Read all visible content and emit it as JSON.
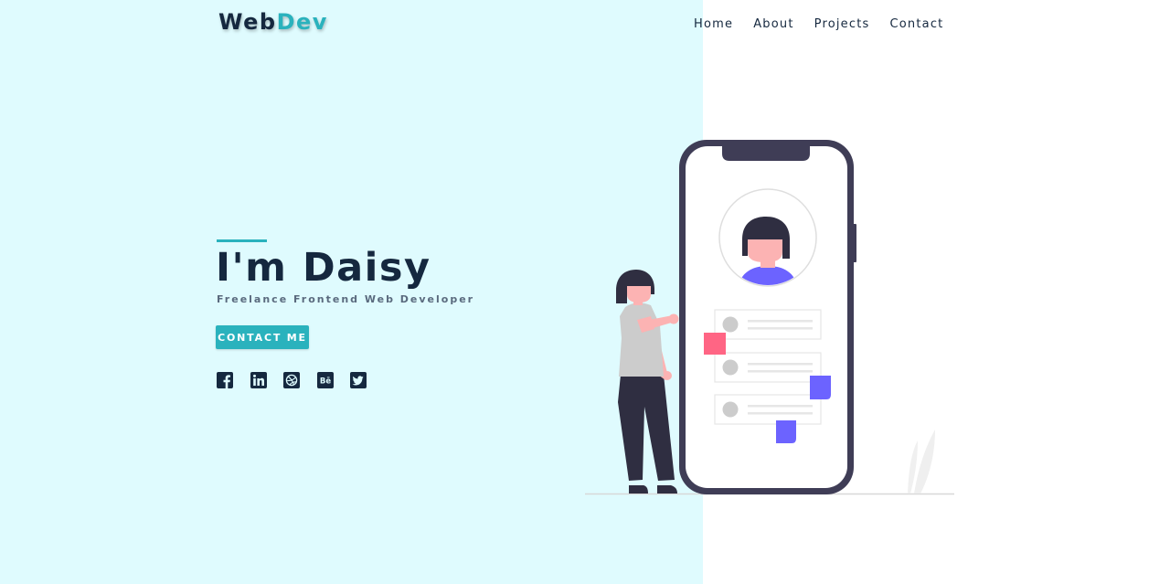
{
  "brand": {
    "part1": "Web",
    "part2": "Dev"
  },
  "nav": {
    "items": [
      "Home",
      "About",
      "Projects",
      "Contact"
    ]
  },
  "hero": {
    "title": "I'm Daisy",
    "subtitle": "Freelance Frontend Web Developer",
    "cta_label": "CONTACT ME"
  },
  "social": {
    "icons": [
      "facebook-icon",
      "linkedin-icon",
      "dribbble-icon",
      "behance-icon",
      "twitter-icon"
    ],
    "behance_glyph": "Bē"
  },
  "colors": {
    "left_panel_bg": "#dffbfe",
    "accent": "#2ab2bd",
    "navy": "#15283f",
    "phone_frame": "#3f3d56",
    "purple": "#6c63ff",
    "pink": "#ff6584"
  }
}
